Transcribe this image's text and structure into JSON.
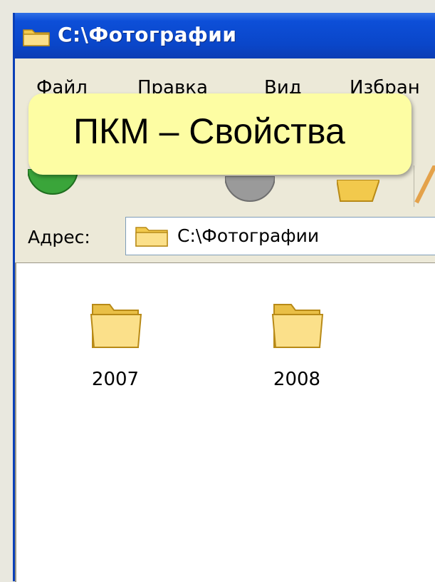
{
  "window": {
    "title": "C:\\Фотографии"
  },
  "menu": {
    "items": [
      "Файл",
      "Правка",
      "Вид",
      "Избран"
    ]
  },
  "address": {
    "label": "Адрес:",
    "value": "C:\\Фотографии"
  },
  "folders": [
    {
      "label": "2007",
      "icon": "folder-icon"
    },
    {
      "label": "2008",
      "icon": "folder-icon"
    }
  ],
  "callout": {
    "text": "ПКМ – Свойства"
  },
  "colors": {
    "titlebar": "#0a46c9",
    "callout_bg": "#fdfda3",
    "folder_fill": "#f5d36a",
    "window_bg": "#ece9d8"
  }
}
